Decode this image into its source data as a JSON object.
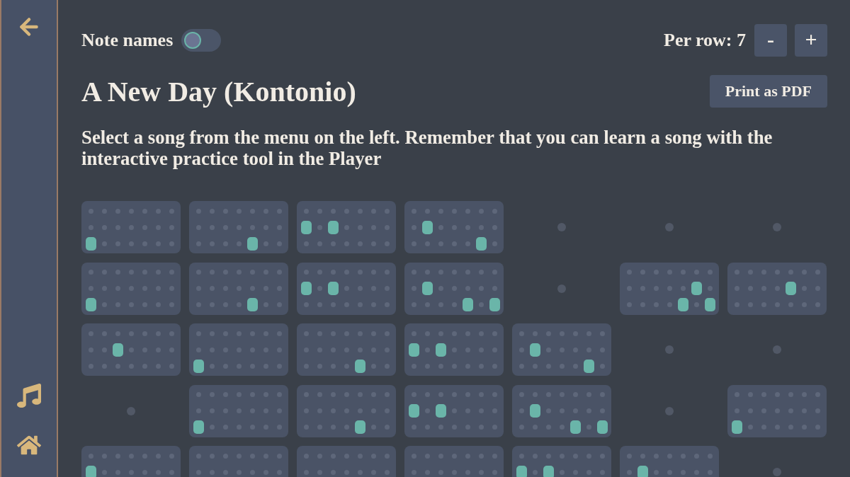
{
  "toolbar": {
    "note_names": {
      "label": "Note names",
      "on": false
    },
    "per_row": {
      "label": "Per row: 7",
      "buttons": [
        "-",
        "+"
      ]
    }
  },
  "song": {
    "title": "A New Day (Kontonio)",
    "print_button": "Print as PDF",
    "description": "Select a song from the menu on the left. Remember that you can learn a song with the interactive practice tool in the Player"
  },
  "sheet": {
    "rows": [
      {
        "beats": [
          {
            "kind": "chord",
            "keys": [
              [
                false,
                false,
                false,
                false,
                false,
                false,
                false
              ],
              [
                false,
                false,
                false,
                false,
                false,
                false,
                false
              ],
              [
                true,
                false,
                false,
                false,
                false,
                false,
                false
              ]
            ]
          },
          {
            "kind": "chord",
            "keys": [
              [
                false,
                false,
                false,
                false,
                false,
                false,
                false
              ],
              [
                false,
                false,
                false,
                false,
                false,
                false,
                false
              ],
              [
                false,
                false,
                false,
                false,
                true,
                false,
                false
              ]
            ]
          },
          {
            "kind": "chord",
            "keys": [
              [
                false,
                false,
                false,
                false,
                false,
                false,
                false
              ],
              [
                true,
                false,
                true,
                false,
                false,
                false,
                false
              ],
              [
                false,
                false,
                false,
                false,
                false,
                false,
                false
              ]
            ]
          },
          {
            "kind": "chord",
            "keys": [
              [
                false,
                false,
                false,
                false,
                false,
                false,
                false
              ],
              [
                false,
                true,
                false,
                false,
                false,
                false,
                false
              ],
              [
                false,
                false,
                false,
                false,
                false,
                true,
                false
              ]
            ]
          },
          {
            "kind": "rest"
          },
          {
            "kind": "rest"
          },
          {
            "kind": "rest"
          }
        ]
      },
      {
        "beats": [
          {
            "kind": "chord",
            "keys": [
              [
                false,
                false,
                false,
                false,
                false,
                false,
                false
              ],
              [
                false,
                false,
                false,
                false,
                false,
                false,
                false
              ],
              [
                true,
                false,
                false,
                false,
                false,
                false,
                false
              ]
            ]
          },
          {
            "kind": "chord",
            "keys": [
              [
                false,
                false,
                false,
                false,
                false,
                false,
                false
              ],
              [
                false,
                false,
                false,
                false,
                false,
                false,
                false
              ],
              [
                false,
                false,
                false,
                false,
                true,
                false,
                false
              ]
            ]
          },
          {
            "kind": "chord",
            "keys": [
              [
                false,
                false,
                false,
                false,
                false,
                false,
                false
              ],
              [
                true,
                false,
                true,
                false,
                false,
                false,
                false
              ],
              [
                false,
                false,
                false,
                false,
                false,
                false,
                false
              ]
            ]
          },
          {
            "kind": "chord",
            "keys": [
              [
                false,
                false,
                false,
                false,
                false,
                false,
                false
              ],
              [
                false,
                true,
                false,
                false,
                false,
                false,
                false
              ],
              [
                false,
                false,
                false,
                false,
                true,
                false,
                true
              ]
            ]
          },
          {
            "kind": "rest"
          },
          {
            "kind": "chord",
            "keys": [
              [
                false,
                false,
                false,
                false,
                false,
                false,
                false
              ],
              [
                false,
                false,
                false,
                false,
                false,
                true,
                false
              ],
              [
                false,
                false,
                false,
                false,
                true,
                false,
                true
              ]
            ]
          },
          {
            "kind": "chord",
            "keys": [
              [
                false,
                false,
                false,
                false,
                false,
                false,
                false
              ],
              [
                false,
                false,
                false,
                false,
                true,
                false,
                false
              ],
              [
                false,
                false,
                false,
                false,
                false,
                false,
                false
              ]
            ]
          }
        ]
      },
      {
        "beats": [
          {
            "kind": "chord",
            "keys": [
              [
                false,
                false,
                false,
                false,
                false,
                false,
                false
              ],
              [
                false,
                false,
                true,
                false,
                false,
                false,
                false
              ],
              [
                false,
                false,
                false,
                false,
                false,
                false,
                false
              ]
            ]
          },
          {
            "kind": "chord",
            "keys": [
              [
                false,
                false,
                false,
                false,
                false,
                false,
                false
              ],
              [
                false,
                false,
                false,
                false,
                false,
                false,
                false
              ],
              [
                true,
                false,
                false,
                false,
                false,
                false,
                false
              ]
            ]
          },
          {
            "kind": "chord",
            "keys": [
              [
                false,
                false,
                false,
                false,
                false,
                false,
                false
              ],
              [
                false,
                false,
                false,
                false,
                false,
                false,
                false
              ],
              [
                false,
                false,
                false,
                false,
                true,
                false,
                false
              ]
            ]
          },
          {
            "kind": "chord",
            "keys": [
              [
                false,
                false,
                false,
                false,
                false,
                false,
                false
              ],
              [
                true,
                false,
                true,
                false,
                false,
                false,
                false
              ],
              [
                false,
                false,
                false,
                false,
                false,
                false,
                false
              ]
            ]
          },
          {
            "kind": "chord",
            "keys": [
              [
                false,
                false,
                false,
                false,
                false,
                false,
                false
              ],
              [
                false,
                true,
                false,
                false,
                false,
                false,
                false
              ],
              [
                false,
                false,
                false,
                false,
                false,
                true,
                false
              ]
            ]
          },
          {
            "kind": "rest"
          },
          {
            "kind": "rest"
          }
        ]
      },
      {
        "beats": [
          {
            "kind": "rest"
          },
          {
            "kind": "chord",
            "keys": [
              [
                false,
                false,
                false,
                false,
                false,
                false,
                false
              ],
              [
                false,
                false,
                false,
                false,
                false,
                false,
                false
              ],
              [
                true,
                false,
                false,
                false,
                false,
                false,
                false
              ]
            ]
          },
          {
            "kind": "chord",
            "keys": [
              [
                false,
                false,
                false,
                false,
                false,
                false,
                false
              ],
              [
                false,
                false,
                false,
                false,
                false,
                false,
                false
              ],
              [
                false,
                false,
                false,
                false,
                true,
                false,
                false
              ]
            ]
          },
          {
            "kind": "chord",
            "keys": [
              [
                false,
                false,
                false,
                false,
                false,
                false,
                false
              ],
              [
                true,
                false,
                true,
                false,
                false,
                false,
                false
              ],
              [
                false,
                false,
                false,
                false,
                false,
                false,
                false
              ]
            ]
          },
          {
            "kind": "chord",
            "keys": [
              [
                false,
                false,
                false,
                false,
                false,
                false,
                false
              ],
              [
                false,
                true,
                false,
                false,
                false,
                false,
                false
              ],
              [
                false,
                false,
                false,
                false,
                true,
                false,
                true
              ]
            ]
          },
          {
            "kind": "rest"
          },
          {
            "kind": "chord",
            "keys": [
              [
                false,
                false,
                false,
                false,
                false,
                false,
                false
              ],
              [
                false,
                false,
                false,
                false,
                false,
                false,
                false
              ],
              [
                true,
                false,
                false,
                false,
                false,
                false,
                false
              ]
            ]
          }
        ]
      },
      {
        "beats": [
          {
            "kind": "chord",
            "keys": [
              [
                false,
                false,
                false,
                false,
                false,
                false,
                false
              ],
              [
                true,
                false,
                false,
                false,
                false,
                false,
                false
              ]
            ]
          },
          {
            "kind": "chord",
            "keys": [
              [
                false,
                false,
                false,
                false,
                false,
                false,
                false
              ],
              [
                false,
                false,
                false,
                false,
                false,
                false,
                false
              ]
            ]
          },
          {
            "kind": "chord",
            "keys": [
              [
                false,
                false,
                false,
                false,
                false,
                false,
                false
              ],
              [
                false,
                false,
                false,
                false,
                false,
                false,
                false
              ]
            ]
          },
          {
            "kind": "chord",
            "keys": [
              [
                false,
                false,
                false,
                false,
                false,
                false,
                false
              ],
              [
                false,
                false,
                false,
                false,
                false,
                false,
                false
              ]
            ]
          },
          {
            "kind": "chord",
            "keys": [
              [
                false,
                false,
                false,
                false,
                false,
                false,
                false
              ],
              [
                true,
                false,
                true,
                false,
                false,
                false,
                false
              ]
            ]
          },
          {
            "kind": "chord",
            "keys": [
              [
                false,
                false,
                false,
                false,
                false,
                false,
                false
              ],
              [
                false,
                true,
                false,
                false,
                false,
                false,
                false
              ]
            ]
          },
          {
            "kind": "rest"
          }
        ]
      }
    ]
  }
}
